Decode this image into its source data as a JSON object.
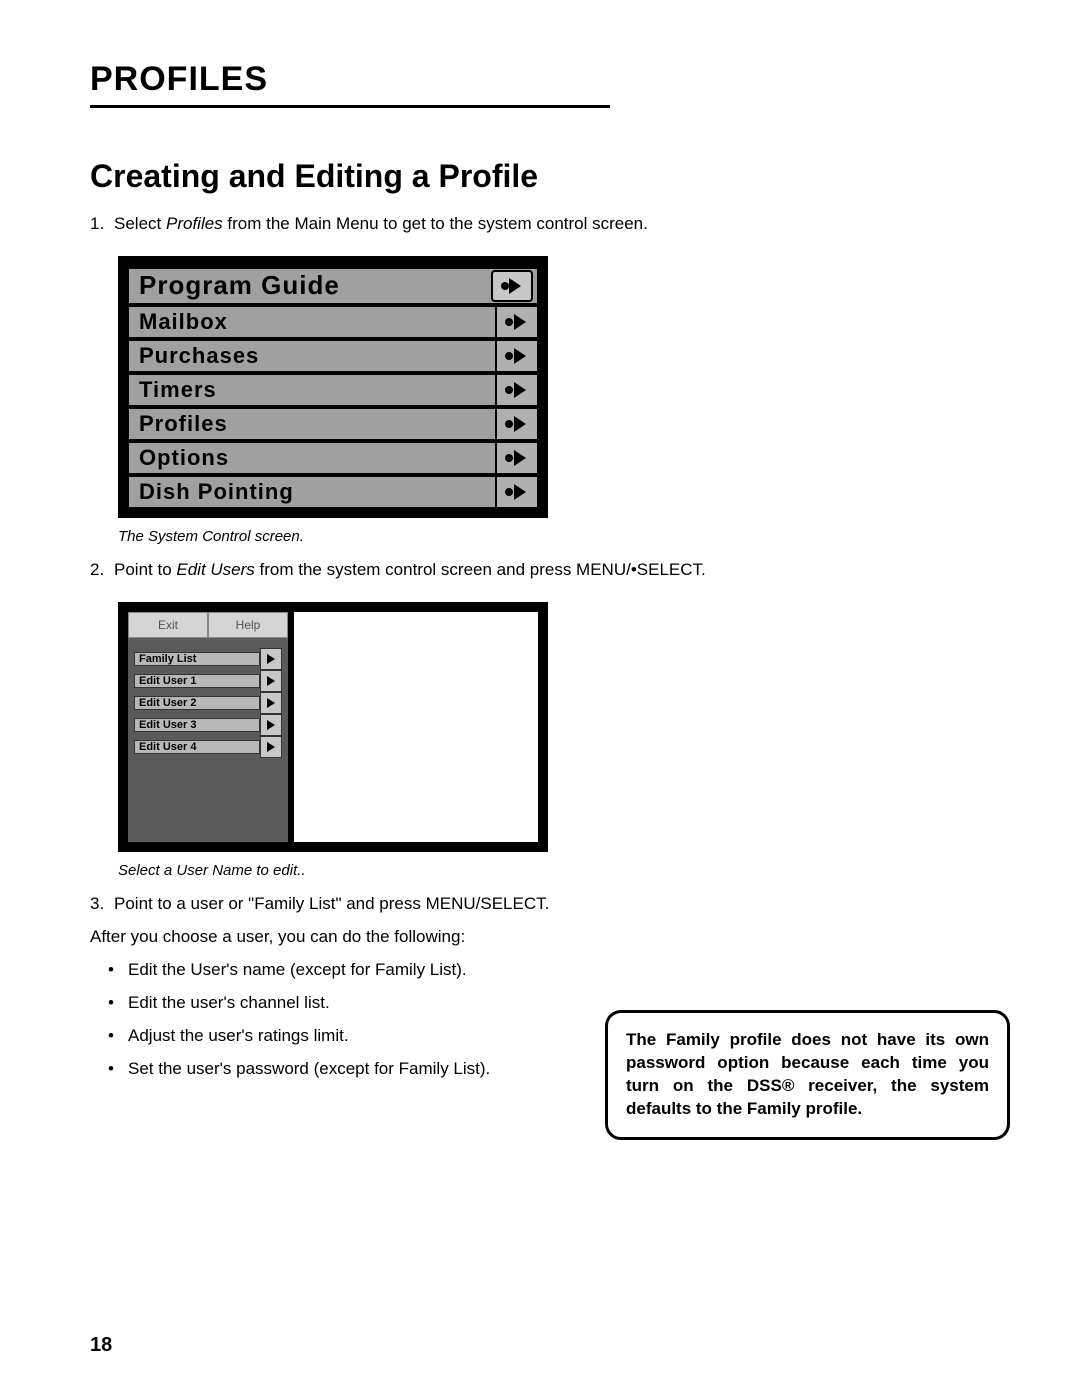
{
  "section_title": "PROFILES",
  "page_title": "Creating and Editing a Profile",
  "steps": {
    "s1_num": "1.",
    "s1_a": "Select ",
    "s1_italic": "Profiles",
    "s1_b": " from the Main Menu to get to the system control screen.",
    "s2_num": "2.",
    "s2_a": "Point to ",
    "s2_italic": "Edit Users",
    "s2_b": " from the system control screen and press MENU/•SELECT.",
    "s3_num": "3.",
    "s3": "Point to a user or \"Family List\" and press MENU/SELECT."
  },
  "fig1": {
    "items": [
      "Program Guide",
      "Mailbox",
      "Purchases",
      "Timers",
      "Profiles",
      "Options",
      "Dish Pointing"
    ],
    "caption": "The System Control screen."
  },
  "fig2": {
    "tabs": [
      "Exit",
      "Help"
    ],
    "items": [
      "Family List",
      "Edit User 1",
      "Edit User 2",
      "Edit User 3",
      "Edit User 4"
    ],
    "caption": "Select a User Name to edit.."
  },
  "after_para": "After you choose a user, you can do the following:",
  "bullets": [
    "Edit the User's name (except for Family List).",
    "Edit the user's channel list.",
    "Adjust the user's ratings limit.",
    "Set the user's password (except for Family List)."
  ],
  "note": "The Family profile does not have its own password option because each time you turn on the DSS® receiver, the system defaults to the Family profile.",
  "page_number": "18"
}
